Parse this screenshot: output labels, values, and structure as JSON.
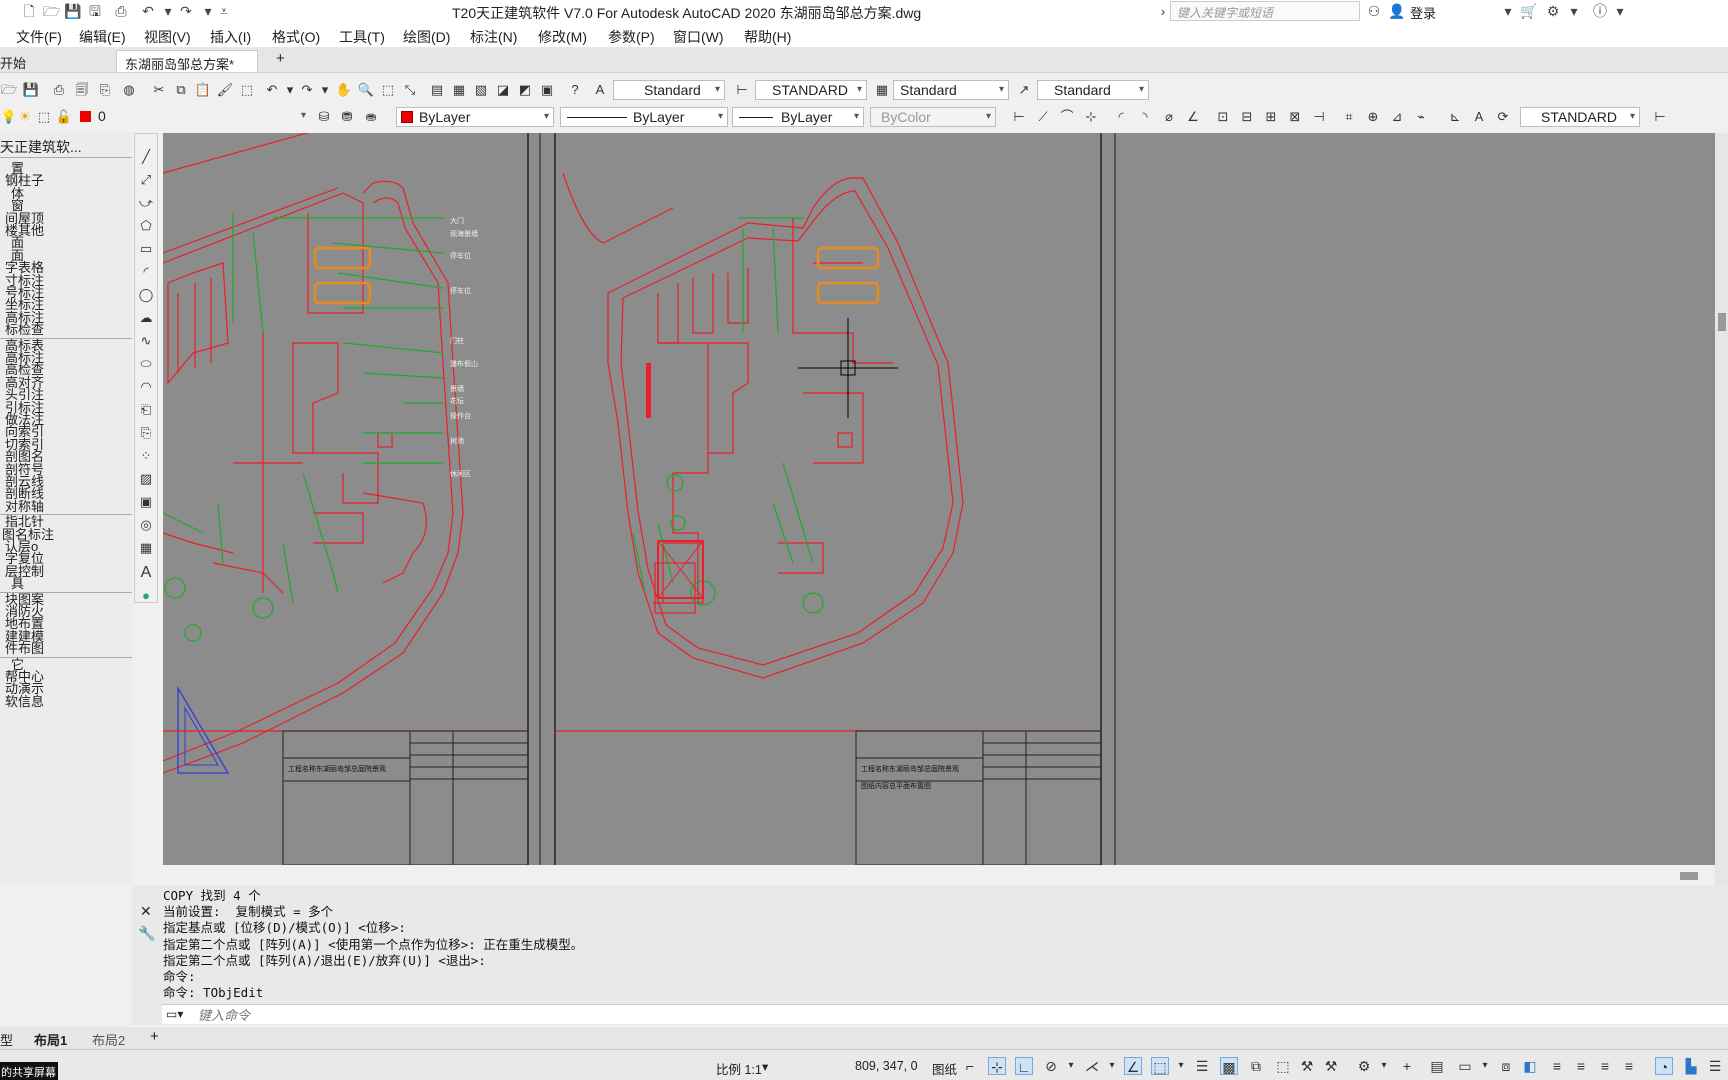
{
  "titlebar": {
    "title": "T20天正建筑软件 V7.0 For Autodesk AutoCAD 2020    东湖丽岛邹总方案.dwg",
    "search_placeholder": "键入关键字或短语",
    "login_label": "登录"
  },
  "menubar": {
    "items": [
      "文件(F)",
      "编辑(E)",
      "视图(V)",
      "插入(I)",
      "格式(O)",
      "工具(T)",
      "绘图(D)",
      "标注(N)",
      "修改(M)",
      "参数(P)",
      "窗口(W)",
      "帮助(H)"
    ]
  },
  "doctabs": {
    "start_label": "开始",
    "active_label": "东湖丽岛邹总方案*",
    "add_label": "+"
  },
  "toolbar2": {
    "text_style": "Standard",
    "dim_style": "STANDARD",
    "table_style": "Standard",
    "mleader_style": "Standard"
  },
  "toolbar3": {
    "layer": "0",
    "color": "ByLayer",
    "linetype": "ByLayer",
    "lineweight": "ByLayer",
    "plotstyle": "ByColor",
    "dimstyle": "STANDARD"
  },
  "palette": {
    "title": "天正建筑软...",
    "items": [
      "置",
      "钢柱子",
      "体",
      "窗",
      "间屋顶",
      "楼其他",
      "面",
      "面",
      "字表格",
      "寸标注",
      "号标注",
      "坐标注",
      "高标注",
      "标检查",
      "高标表",
      "高标注",
      "高检查",
      "高对齐",
      "头引注",
      "引标注",
      "做法注",
      "向索引",
      "切索引",
      "剖图名",
      "剖符号",
      "剖云线",
      "剖断线",
      "对称轴",
      "指北针",
      "图名标注",
      "认层o",
      "字复位",
      "层控制",
      "具",
      "块图案",
      "消防火",
      "地布置",
      "建建模",
      "件布图",
      "它",
      "帮中心",
      "动演示",
      "软信息"
    ]
  },
  "commands": {
    "history": [
      "COPY 找到 4 个",
      "当前设置:  复制模式 = 多个",
      "指定基点或 [位移(D)/模式(O)] <位移>:",
      "指定第二个点或 [阵列(A)] <使用第一个点作为位移>: 正在重生成模型。",
      "指定第二个点或 [阵列(A)/退出(E)/放弃(U)] <退出>:",
      "命令:",
      "命令: TObjEdit"
    ],
    "input_placeholder": "键入命令"
  },
  "drawing": {
    "labels_left": [
      "大门",
      "观海景墙",
      "停车位",
      "停车位",
      "门柱",
      "瀑布假山",
      "景墙",
      "花坛",
      "操作台",
      "树池",
      "休闲区"
    ],
    "title_block": {
      "project_label": "工程名称",
      "project_name": "东湖丽岛邹总庭院景观",
      "drawing_label": "图纸内容",
      "drawing_name": "总平面布置图"
    }
  },
  "layouttabs": {
    "model": "型",
    "layout1": "布局1",
    "layout2": "布局2",
    "add": "+"
  },
  "statusbar": {
    "share_label": "的共享屏幕",
    "scale": "比例 1:1",
    "coords": "809, 347, 0",
    "paper": "图纸"
  },
  "colors": {
    "canvas_bg": "#8c8c8c",
    "red_line": "#e8202a",
    "green_line": "#1faa2a",
    "orange_parking": "#e88a1e",
    "blue_triangle": "#2b3fd8"
  }
}
